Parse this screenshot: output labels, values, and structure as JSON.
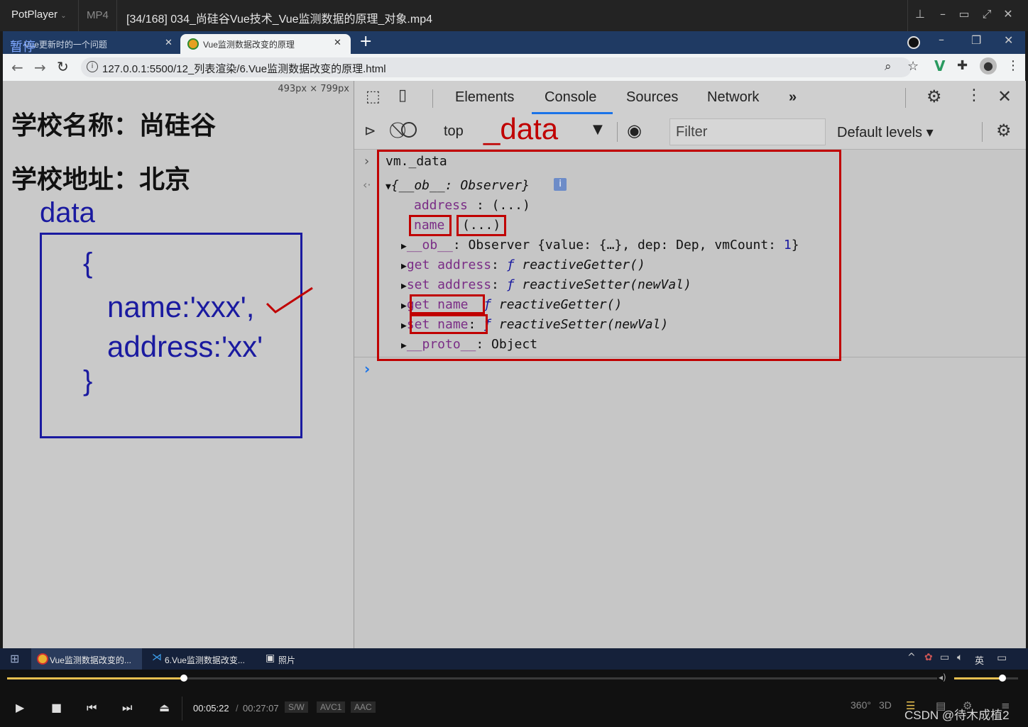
{
  "player": {
    "app_name": "PotPlayer",
    "format": "MP4",
    "file_title": "[34/168] 034_尚硅谷Vue技术_Vue监测数据的原理_对象.mp4",
    "pause_label": "暂停",
    "current_time": "00:05:22",
    "total_time": "00:27:07",
    "badges": [
      "S/W",
      "AVC1",
      "AAC"
    ],
    "progress_fraction": 0.19,
    "volume_fraction": 0.75,
    "right_buttons": [
      "360°",
      "3D"
    ],
    "watermark": "CSDN @待木成植2"
  },
  "browser": {
    "tabs": [
      {
        "label": "Vue更新时的一个问题"
      },
      {
        "label": "Vue监测数据改变的原理"
      }
    ],
    "url": "127.0.0.1:5500/12_列表渲染/6.Vue监测数据改变的原理.html",
    "viewport_size": "493px × 799px"
  },
  "page": {
    "school_name": "学校名称：尚硅谷",
    "school_address": "学校地址：北京",
    "annotation_title": "data",
    "annotation_open": "{",
    "annotation_line1": "name:'xxx',",
    "annotation_line2": "address:'xx'",
    "annotation_close": "}"
  },
  "devtools": {
    "tabs": [
      "Elements",
      "Console",
      "Sources",
      "Network"
    ],
    "more": "»",
    "context": "top",
    "filter_placeholder": "Filter",
    "levels": "Default levels",
    "annotation": "_data",
    "console": {
      "input": "vm._data",
      "obj_summary_prefix": "{__ob__: ",
      "obj_summary_class": "Observer",
      "obj_summary_suffix": "}",
      "address_key": "address",
      "address_val": ": (...)",
      "name_key": "name",
      "name_val": "(...)",
      "ob_key": "__ob__",
      "ob_val": ": Observer {value: {…}, dep: Dep, vmCount: ",
      "ob_count": "1",
      "ob_end": "}",
      "get_address": "get address",
      "set_address": "set address",
      "get_name": "get name",
      "set_name": "set name",
      "f": "ƒ",
      "getter": "reactiveGetter()",
      "setter": "reactiveSetter(newVal)",
      "proto_key": "__proto__",
      "proto_val": ": Object"
    }
  },
  "taskbar": {
    "items": [
      "Vue监测数据改变的...",
      "6.Vue监测数据改变...",
      "照片"
    ],
    "ime": "英"
  }
}
